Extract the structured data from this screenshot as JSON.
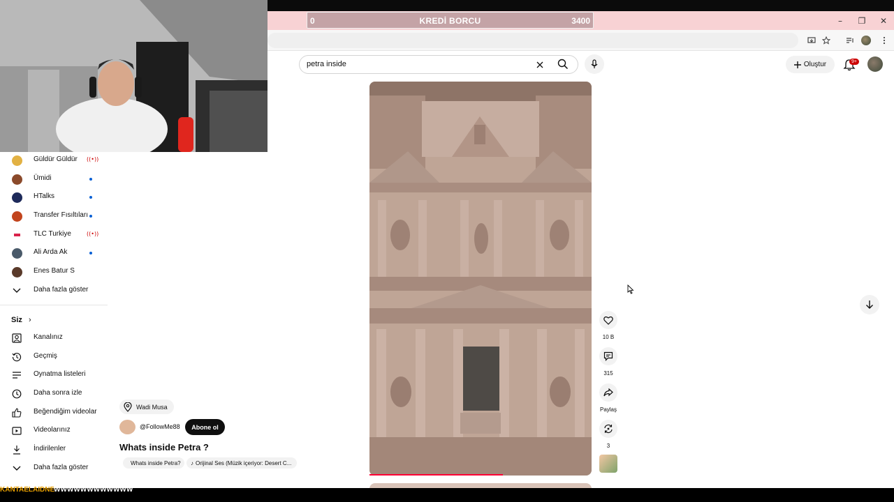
{
  "overlay": {
    "progress_left": "0",
    "progress_title": "KREDİ BORCU",
    "progress_right": "3400",
    "progress_fraction": 0.0
  },
  "window_controls": [
    "–",
    "❐",
    "✕"
  ],
  "youtube": {
    "search": {
      "value": "petra inside"
    },
    "create_label": "Oluştur",
    "notification_badge": "9+"
  },
  "sidebar": {
    "subscriptions": [
      {
        "label": "Güldür Güldür",
        "indicator": "live",
        "color": "#e2b143"
      },
      {
        "label": "Ümidi",
        "indicator": "dot",
        "color": "#8b4a2b"
      },
      {
        "label": "HTalks",
        "indicator": "dot",
        "color": "#1e2a5a"
      },
      {
        "label": "Transfer Fısıltıları",
        "indicator": "dot",
        "color": "#c2441d"
      },
      {
        "label": "TLC Turkiye",
        "indicator": "live",
        "color": "#d9234b"
      },
      {
        "label": "Ali Arda Ak",
        "indicator": "dot",
        "color": "#4a5a6a"
      },
      {
        "label": "Enes Batur S",
        "indicator": "none",
        "color": "#5a3a2a"
      }
    ],
    "show_more_1": "Daha fazla göster",
    "you_heading": "Siz",
    "you_items": [
      {
        "label": "Kanalınız",
        "icon": "channel-icon"
      },
      {
        "label": "Geçmiş",
        "icon": "history-icon"
      },
      {
        "label": "Oynatma listeleri",
        "icon": "playlists-icon"
      },
      {
        "label": "Daha sonra izle",
        "icon": "watch-later-icon"
      },
      {
        "label": "Beğendiğim videolar",
        "icon": "like-icon"
      },
      {
        "label": "Videolarınız",
        "icon": "your-videos-icon"
      },
      {
        "label": "İndirilenler",
        "icon": "download-icon"
      }
    ],
    "show_more_2": "Daha fazla göster"
  },
  "short": {
    "location": "Wadi Musa",
    "channel_handle": "@FollowMe88",
    "subscribe_label": "Abone ol",
    "title": "Whats inside Petra ?",
    "pill_1": "Whats inside Petra?",
    "pill_2": "Orijinal Ses (Müzik içeriyor: Desert C...",
    "like_count": "10 B",
    "comment_count": "315",
    "share_label": "Paylaş",
    "remix_count": "3",
    "playback_fraction": 0.6
  },
  "ticker": {
    "part_a": "KANTAELAIDNE",
    "part_b": "WWWWWWWWWWWW"
  }
}
